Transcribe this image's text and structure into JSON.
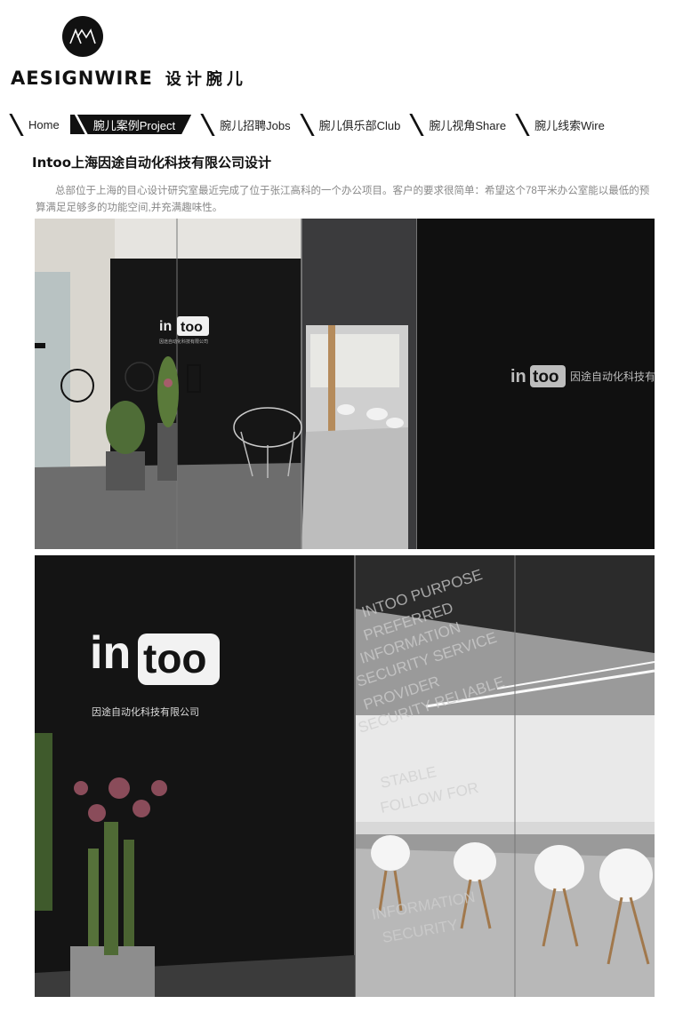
{
  "brand": {
    "logo_mark": "AW",
    "name_en": "AESIGNWIRE",
    "name_cn": "设计腕儿"
  },
  "nav": {
    "items": [
      {
        "label": "Home",
        "active": false
      },
      {
        "label": "腕儿案例Project",
        "active": true
      },
      {
        "label": "腕儿招聘Jobs",
        "active": false
      },
      {
        "label": "腕儿俱乐部Club",
        "active": false
      },
      {
        "label": "腕儿视角Share",
        "active": false
      },
      {
        "label": "腕儿线索Wire",
        "active": false
      }
    ]
  },
  "article": {
    "title": "Intoo上海因途自动化科技有限公司设计",
    "description": "总部位于上海的目心设计研究室最近完成了位于张江高科的一个办公项目。客户的要求很简单：希望这个78平米办公室能以最低的预算满足足够多的功能空间,并充满趣味性。",
    "photo1": {
      "sign_in": "in",
      "sign_too": "too",
      "sign_sub": "因途自动化科技有限公司",
      "glass_sign": "因途自动化科技有"
    },
    "photo2": {
      "sign_in": "in",
      "sign_too": "too",
      "sign_sub": "因途自动化科技有限公司",
      "glass_text": [
        "INTOO PURPOSE",
        "PREFERRED",
        "INFORMATION",
        "SECURITY SERVICE",
        "PROVIDER",
        "SECURITY RELIABLE",
        "STABLE",
        "FOLLOW FOR",
        "INFORMATION",
        "SECURITY"
      ]
    }
  }
}
